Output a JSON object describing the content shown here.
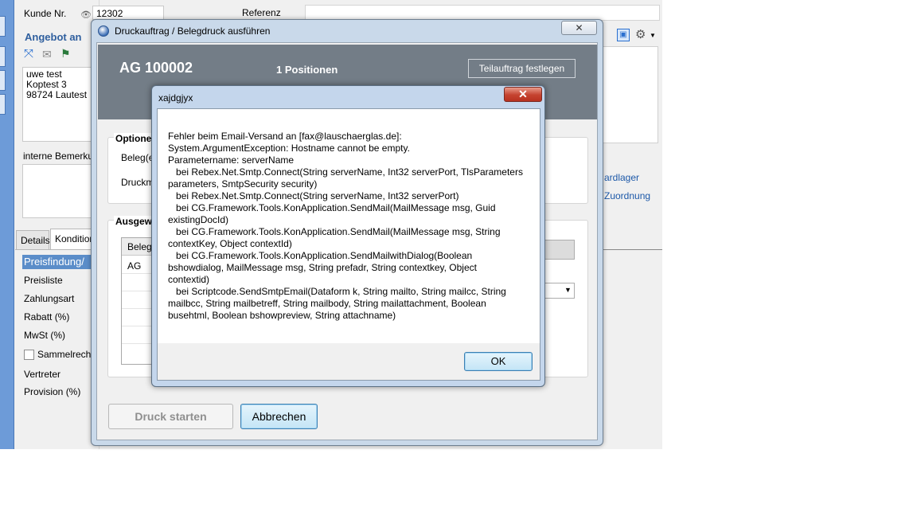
{
  "background_app": {
    "kunde_label": "Kunde Nr.",
    "kunde_value": "12302",
    "referenz_label": "Referenz",
    "angebot_title": "Angebot an",
    "address": [
      "uwe test",
      "Koptest 3",
      "98724 Lautest"
    ],
    "bemerkung_label": "interne Bemerkun",
    "tabs": [
      "Details",
      "Konditionen"
    ],
    "preisfindung_header": "Preisfindung/",
    "fields": [
      "Preisliste",
      "Zahlungsart",
      "Rabatt (%)",
      "MwSt (%)",
      "Sammelrechn",
      "Vertreter",
      "Provision (%)"
    ],
    "right_links": [
      "ardlager",
      "Zuordnung"
    ]
  },
  "print_dialog": {
    "title": "Druckauftrag / Belegdruck ausführen",
    "close_label": "✕",
    "document_number": "AG 100002",
    "positions": "1 Positionen",
    "teilauftrag_button": "Teilauftrag festlegen",
    "options_label": "Optionen",
    "beleg_label": "Beleg(e",
    "druck_label": "Druckm",
    "ausgewaehlt_label": "Ausgewä",
    "grid_header": "Belega",
    "grid_row": "AG",
    "druck_button": "Druck starten",
    "abbrechen_button": "Abbrechen"
  },
  "message_box": {
    "title": "xajdgjyx",
    "close_label": "✕",
    "text": "Fehler beim Email-Versand an [fax@lauschaerglas.de]:\nSystem.ArgumentException: Hostname cannot be empty.\nParametername: serverName\n   bei Rebex.Net.Smtp.Connect(String serverName, Int32 serverPort, TlsParameters\nparameters, SmtpSecurity security)\n   bei Rebex.Net.Smtp.Connect(String serverName, Int32 serverPort)\n   bei CG.Framework.Tools.KonApplication.SendMail(MailMessage msg, Guid\nexistingDocId)\n   bei CG.Framework.Tools.KonApplication.SendMail(MailMessage msg, String\ncontextKey, Object contextId)\n   bei CG.Framework.Tools.KonApplication.SendMailwithDialog(Boolean\nbshowdialog, MailMessage msg, String prefadr, String contextkey, Object\ncontextid)\n   bei Scriptcode.SendSmtpEmail(Dataform k, String mailto, String mailcc, String\nmailbcc, String mailbetreff, String mailbody, String mailattachment, Boolean\nbusehtml, Boolean bshowpreview, String attachname)",
    "ok_label": "OK"
  },
  "colors": {
    "accent_blue": "#2f5f9e",
    "dialog_header": "#737d87",
    "close_red": "#c5422f"
  }
}
